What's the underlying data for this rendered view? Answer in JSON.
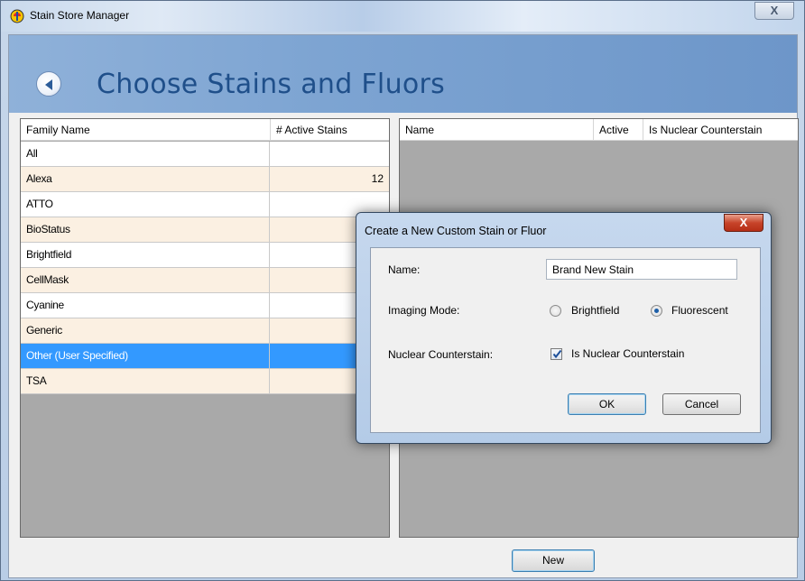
{
  "window": {
    "title": "Stain Store Manager",
    "close_glyph": "X"
  },
  "banner": {
    "title": "Choose Stains and Fluors",
    "back_icon": "back-arrow-icon"
  },
  "left_grid": {
    "columns": [
      "Family Name",
      "# Active Stains"
    ],
    "rows": [
      {
        "name": "All",
        "count": "",
        "style": "white"
      },
      {
        "name": "Alexa",
        "count": "12",
        "style": "tan"
      },
      {
        "name": "ATTO",
        "count": "",
        "style": "white"
      },
      {
        "name": "BioStatus",
        "count": "",
        "style": "tan"
      },
      {
        "name": "Brightfield",
        "count": "",
        "style": "white"
      },
      {
        "name": "CellMask",
        "count": "",
        "style": "tan"
      },
      {
        "name": "Cyanine",
        "count": "",
        "style": "white"
      },
      {
        "name": "Generic",
        "count": "",
        "style": "tan"
      },
      {
        "name": "Other (User Specified)",
        "count": "",
        "style": "selected"
      },
      {
        "name": "TSA",
        "count": "",
        "style": "tan"
      }
    ]
  },
  "right_grid": {
    "columns": [
      "Name",
      "Active",
      "Is Nuclear Counterstain"
    ]
  },
  "bottom": {
    "new_label": "New"
  },
  "dialog": {
    "title": "Create a New Custom Stain or Fluor",
    "close_glyph": "X",
    "name_label": "Name:",
    "name_value": "Brand New Stain",
    "imaging_mode_label": "Imaging Mode:",
    "imaging_options": [
      {
        "label": "Brightfield",
        "checked": false
      },
      {
        "label": "Fluorescent",
        "checked": true
      }
    ],
    "nuclear_label": "Nuclear Counterstain:",
    "nuclear_checkbox_label": "Is Nuclear Counterstain",
    "nuclear_checked": true,
    "ok_label": "OK",
    "cancel_label": "Cancel"
  },
  "colors": {
    "selected_row": "#3399ff",
    "tan_row": "#fbf0e2",
    "title_text": "#1f4f8a",
    "dialog_close": "#c7442a"
  }
}
